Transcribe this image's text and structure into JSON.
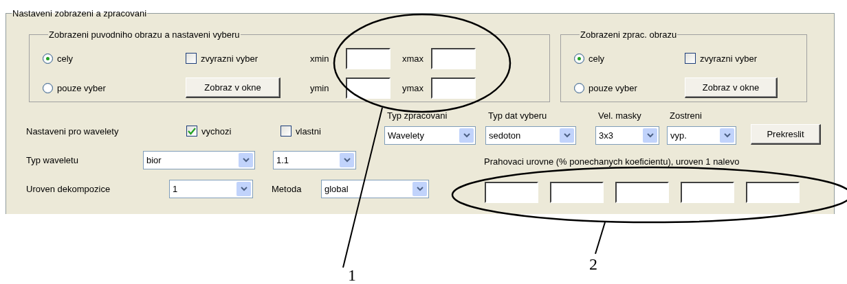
{
  "panel": {
    "title": "Nastaveni zobrazeni a zpracovani"
  },
  "source_group": {
    "title": "Zobrazeni puvodniho obrazu a nastaveni vyberu",
    "radios": [
      {
        "label": "cely",
        "selected": true
      },
      {
        "label": "pouze vyber",
        "selected": false
      }
    ],
    "highlight": {
      "label": "zvyrazni vyber",
      "checked": false
    },
    "button": "Zobraz v okne",
    "fields": [
      {
        "label": "xmin"
      },
      {
        "label": "xmax"
      },
      {
        "label": "ymin"
      },
      {
        "label": "ymax"
      }
    ]
  },
  "processed_group": {
    "title": "Zobrazeni zprac. obrazu",
    "radios": [
      {
        "label": "cely",
        "selected": true
      },
      {
        "label": "pouze vyber",
        "selected": false
      }
    ],
    "highlight": {
      "label": "zvyrazni vyber",
      "checked": false
    },
    "button": "Zobraz v okne"
  },
  "wavelet_settings": {
    "label": "Nastaveni pro wavelety",
    "options": [
      {
        "label": "vychozi",
        "checked": true
      },
      {
        "label": "vlastni",
        "checked": false
      }
    ]
  },
  "wavelet_type": {
    "label": "Typ waveletu",
    "family": "bior",
    "variant": "1.1"
  },
  "decomposition": {
    "label": "Uroven dekompozice",
    "value": "1",
    "method_label": "Metoda",
    "method": "global"
  },
  "processing": [
    {
      "label": "Typ zpracovani",
      "value": "Wavelety"
    },
    {
      "label": "Typ dat vyberu",
      "value": "sedoton"
    },
    {
      "label": "Vel. masky",
      "value": "3x3"
    },
    {
      "label": "Zostreni",
      "value": "vyp."
    }
  ],
  "redraw_button": "Prekreslit",
  "thresholds": {
    "label": "Prahovaci urovne (% ponechanych koeficientu), uroven 1 nalevo",
    "fields": [
      {
        "kind": "input"
      },
      {
        "kind": "input"
      },
      {
        "kind": "input"
      },
      {
        "kind": "input"
      },
      {
        "kind": "input"
      }
    ]
  },
  "annotations": [
    {
      "label": "1"
    },
    {
      "label": "2"
    }
  ]
}
